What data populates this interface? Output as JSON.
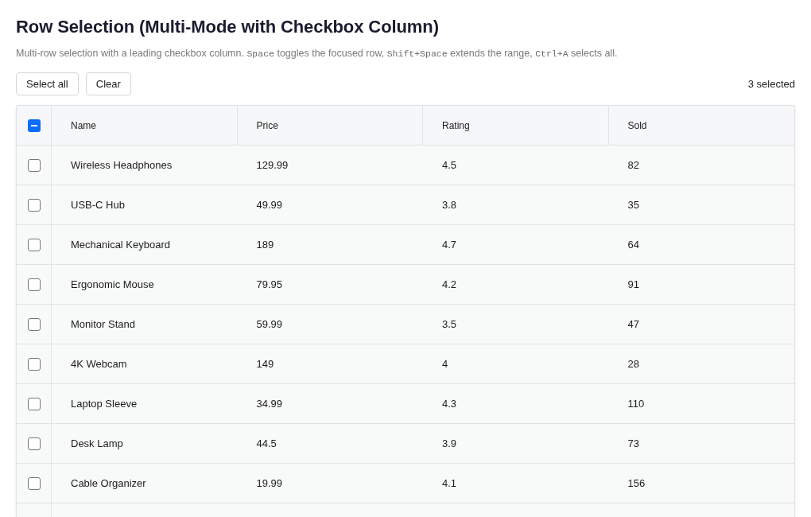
{
  "title": "Row Selection (Multi-Mode with Checkbox Column)",
  "description": [
    {
      "kind": "text",
      "text": "Multi-row selection with a leading checkbox column. "
    },
    {
      "kind": "code",
      "text": "Space"
    },
    {
      "kind": "text",
      "text": " toggles the focused row, "
    },
    {
      "kind": "code",
      "text": "Shift+Space"
    },
    {
      "kind": "text",
      "text": " extends the range, "
    },
    {
      "kind": "code",
      "text": "Ctrl+A"
    },
    {
      "kind": "text",
      "text": " selects all."
    }
  ],
  "toolbar": {
    "buttons": [
      "Select all",
      "Clear"
    ],
    "selection_count": "3 selected"
  },
  "table": {
    "header_checkbox": {
      "indeterminate": true
    },
    "columns": [
      "Name",
      "Price",
      "Rating",
      "Sold"
    ],
    "rows": [
      {
        "selected": false,
        "cells": [
          "Wireless Headphones",
          "129.99",
          "4.5",
          "82"
        ]
      },
      {
        "selected": false,
        "cells": [
          "USB-C Hub",
          "49.99",
          "3.8",
          "35"
        ]
      },
      {
        "selected": false,
        "cells": [
          "Mechanical Keyboard",
          "189",
          "4.7",
          "64"
        ]
      },
      {
        "selected": false,
        "cells": [
          "Ergonomic Mouse",
          "79.95",
          "4.2",
          "91"
        ]
      },
      {
        "selected": false,
        "cells": [
          "Monitor Stand",
          "59.99",
          "3.5",
          "47"
        ]
      },
      {
        "selected": false,
        "cells": [
          "4K Webcam",
          "149",
          "4",
          "28"
        ]
      },
      {
        "selected": false,
        "cells": [
          "Laptop Sleeve",
          "34.99",
          "4.3",
          "110"
        ]
      },
      {
        "selected": false,
        "cells": [
          "Desk Lamp",
          "44.5",
          "3.9",
          "73"
        ]
      },
      {
        "selected": false,
        "cells": [
          "Cable Organizer",
          "19.99",
          "4.1",
          "156"
        ]
      }
    ]
  }
}
